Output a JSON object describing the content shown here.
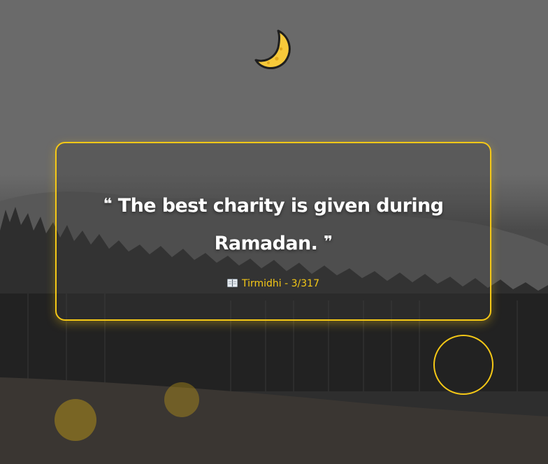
{
  "quote": {
    "open_mark": "❝",
    "text": "The best charity is given during Ramadan.",
    "close_mark": "❞"
  },
  "source": {
    "icon": "book-icon",
    "text": "Tirmidhi - 3/317"
  },
  "decor": {
    "top_icon": "crescent-moon-icon"
  },
  "colors": {
    "accent": "#f5c816",
    "text": "#ffffff",
    "background": "#6a6a6a"
  }
}
